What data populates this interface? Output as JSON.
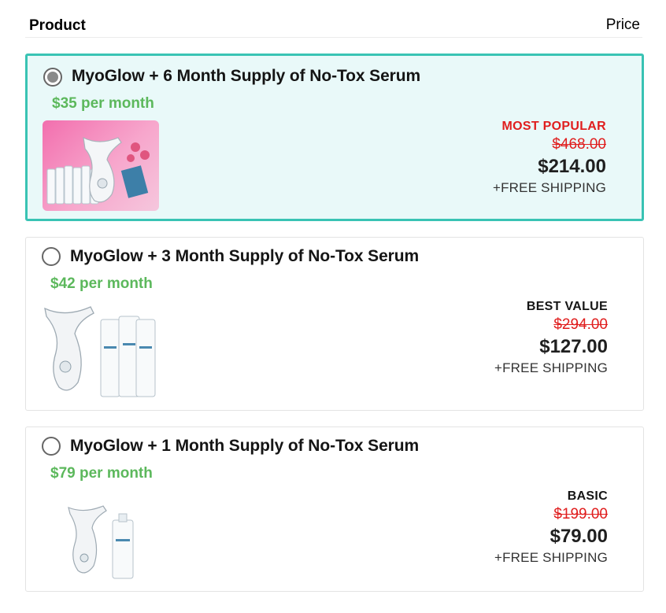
{
  "header": {
    "product_label": "Product",
    "price_label": "Price"
  },
  "colors": {
    "accent": "#39c3b4",
    "selected_bg": "#e9f9f9",
    "monthly_green": "#5cb85c",
    "strike_red": "#e01e1e",
    "most_popular_red": "#e01e1e"
  },
  "offers": [
    {
      "title": "MyoGlow + 6 Month Supply of No-Tox Serum",
      "monthly": "$35 per month",
      "badge": "MOST POPULAR",
      "original_price": "$468.00",
      "price": "$214.00",
      "shipping": "+FREE SHIPPING",
      "selected": true,
      "image": "device-with-6-serum-bottles-pink-background"
    },
    {
      "title": "MyoGlow + 3 Month Supply of No-Tox Serum",
      "monthly": "$42 per month",
      "badge": "BEST VALUE",
      "original_price": "$294.00",
      "price": "$127.00",
      "shipping": "+FREE SHIPPING",
      "selected": false,
      "image": "device-with-3-serum-bottles"
    },
    {
      "title": "MyoGlow + 1 Month Supply of No-Tox Serum",
      "monthly": "$79 per month",
      "badge": "BASIC",
      "original_price": "$199.00",
      "price": "$79.00",
      "shipping": "+FREE SHIPPING",
      "selected": false,
      "image": "device-with-1-serum-bottle"
    }
  ]
}
